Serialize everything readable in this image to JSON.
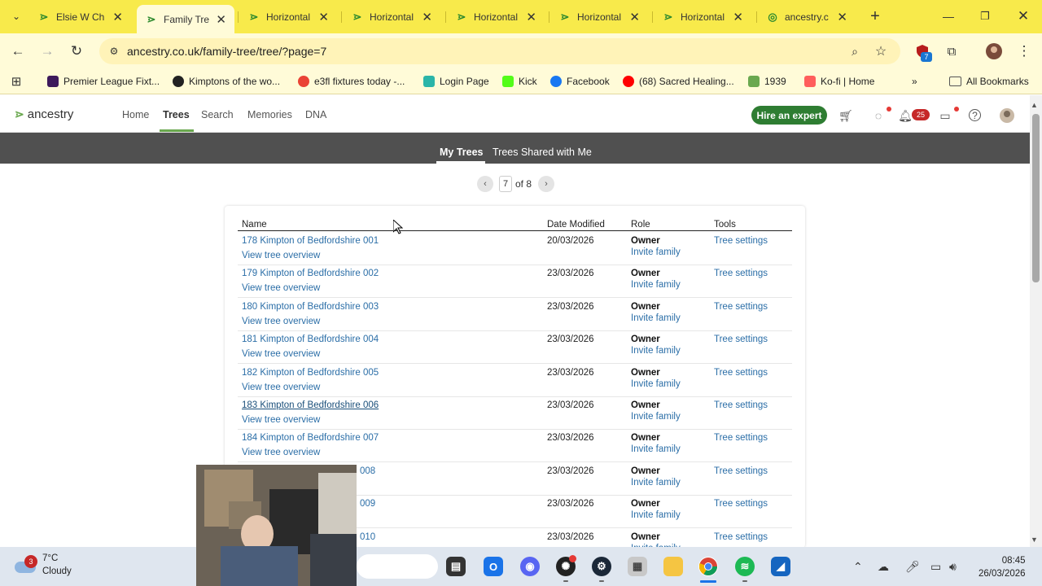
{
  "browser": {
    "tabs": [
      {
        "title": "Elsie W Ch",
        "icon": "ancestry-leaf-icon"
      },
      {
        "title": "Family Tre",
        "icon": "ancestry-leaf-icon",
        "active": true
      },
      {
        "title": "Horizontal",
        "icon": "ancestry-leaf-icon"
      },
      {
        "title": "Horizontal",
        "icon": "ancestry-leaf-icon"
      },
      {
        "title": "Horizontal",
        "icon": "ancestry-leaf-icon"
      },
      {
        "title": "Horizontal",
        "icon": "ancestry-leaf-icon"
      },
      {
        "title": "Horizontal",
        "icon": "ancestry-leaf-icon"
      },
      {
        "title": "ancestry.c",
        "icon": "ancestry-icon"
      }
    ],
    "url": "ancestry.co.uk/family-tree/tree/?page=7",
    "extension_badge": "7",
    "bookmarks": [
      {
        "label": "Premier League Fixt...",
        "color": "#3d195b"
      },
      {
        "label": "Kimptons of the wo...",
        "color": "#222222"
      },
      {
        "label": "e3fl fixtures today -...",
        "color": "#ea4335"
      },
      {
        "label": "Login Page",
        "color": "#2bb5a8"
      },
      {
        "label": "Kick",
        "color": "#53fc18"
      },
      {
        "label": "Facebook",
        "color": "#1877f2"
      },
      {
        "label": "(68) Sacred Healing...",
        "color": "#ff0000"
      },
      {
        "label": "1939",
        "color": "#6aa84f"
      },
      {
        "label": "Ko-fi | Home",
        "color": "#ff5e5b"
      }
    ],
    "all_bookmarks": "All Bookmarks"
  },
  "site": {
    "logo": "ancestry",
    "nav": [
      "Home",
      "Trees",
      "Search",
      "Memories",
      "DNA"
    ],
    "active_nav": "Trees",
    "hire_button": "Hire an expert",
    "notification_count": "25",
    "subnav": [
      "My Trees",
      "Trees Shared with Me"
    ],
    "pager": {
      "current": "7",
      "of_label": "of 8"
    }
  },
  "table": {
    "headers": [
      "Name",
      "Date Modified",
      "Role",
      "Tools"
    ],
    "overview_label": "View tree overview",
    "invite_label": "Invite family",
    "settings_label": "Tree settings",
    "rows": [
      {
        "name": "178 Kimpton of Bedfordshire 001",
        "date": "20/03/2026",
        "role": "Owner"
      },
      {
        "name": "179 Kimpton of Bedfordshire 002",
        "date": "23/03/2026",
        "role": "Owner"
      },
      {
        "name": "180 Kimpton of Bedfordshire 003",
        "date": "23/03/2026",
        "role": "Owner"
      },
      {
        "name": "181 Kimpton of Bedfordshire 004",
        "date": "23/03/2026",
        "role": "Owner"
      },
      {
        "name": "182 Kimpton of Bedfordshire 005",
        "date": "23/03/2026",
        "role": "Owner"
      },
      {
        "name": "183 Kimpton of Bedfordshire 006",
        "date": "23/03/2026",
        "role": "Owner"
      },
      {
        "name": "184 Kimpton of Bedfordshire 007",
        "date": "23/03/2026",
        "role": "Owner"
      },
      {
        "name": "008",
        "date": "23/03/2026",
        "role": "Owner"
      },
      {
        "name": "009",
        "date": "23/03/2026",
        "role": "Owner"
      },
      {
        "name": "010",
        "date": "23/03/2026",
        "role": "Owner"
      }
    ]
  },
  "taskbar": {
    "weather_temp": "7°C",
    "weather_desc": "Cloudy",
    "weather_badge": "3",
    "time": "08:45",
    "date": "26/03/2026"
  }
}
